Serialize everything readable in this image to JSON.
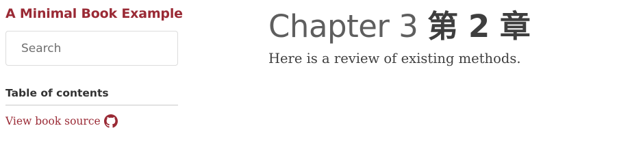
{
  "sidebar": {
    "book_title": "A Minimal Book Example",
    "search": {
      "placeholder": "Search",
      "value": ""
    },
    "toc_heading": "Table of contents",
    "source_link": {
      "label": "View book source",
      "icon": "github-icon"
    }
  },
  "main": {
    "chapter_title": "Chapter 3",
    "chapter_title_cjk": "第 2 章",
    "body_text": "Here is a review of existing methods."
  },
  "colors": {
    "accent": "#9a2a35",
    "heading": "#5e5e5e",
    "text": "#3f3f3f"
  }
}
